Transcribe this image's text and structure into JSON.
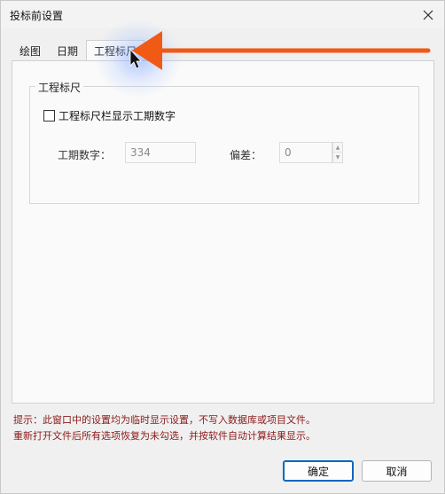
{
  "window": {
    "title": "投标前设置",
    "close_icon": "close-icon"
  },
  "tabs": [
    {
      "label": "绘图",
      "active": false
    },
    {
      "label": "日期",
      "active": false
    },
    {
      "label": "工程标尺",
      "active": true
    }
  ],
  "engineering_ruler": {
    "group_title": "工程标尺",
    "show_duration_checkbox": {
      "label": "工程标尺栏显示工期数字",
      "checked": false
    },
    "duration_label": "工期数字：",
    "duration_value": "334",
    "deviation_label": "偏差：",
    "deviation_value": "0"
  },
  "hint": {
    "line1": "提示：此窗口中的设置均为临时显示设置，不写入数据库或项目文件。",
    "line2": "重新打开文件后所有选项恢复为未勾选，并按软件自动计算结果显示。"
  },
  "buttons": {
    "ok": "确定",
    "cancel": "取消"
  },
  "colors": {
    "annotation_arrow": "#f05a14",
    "hint_text": "#8b1a1a",
    "primary_border": "#0067c0"
  }
}
